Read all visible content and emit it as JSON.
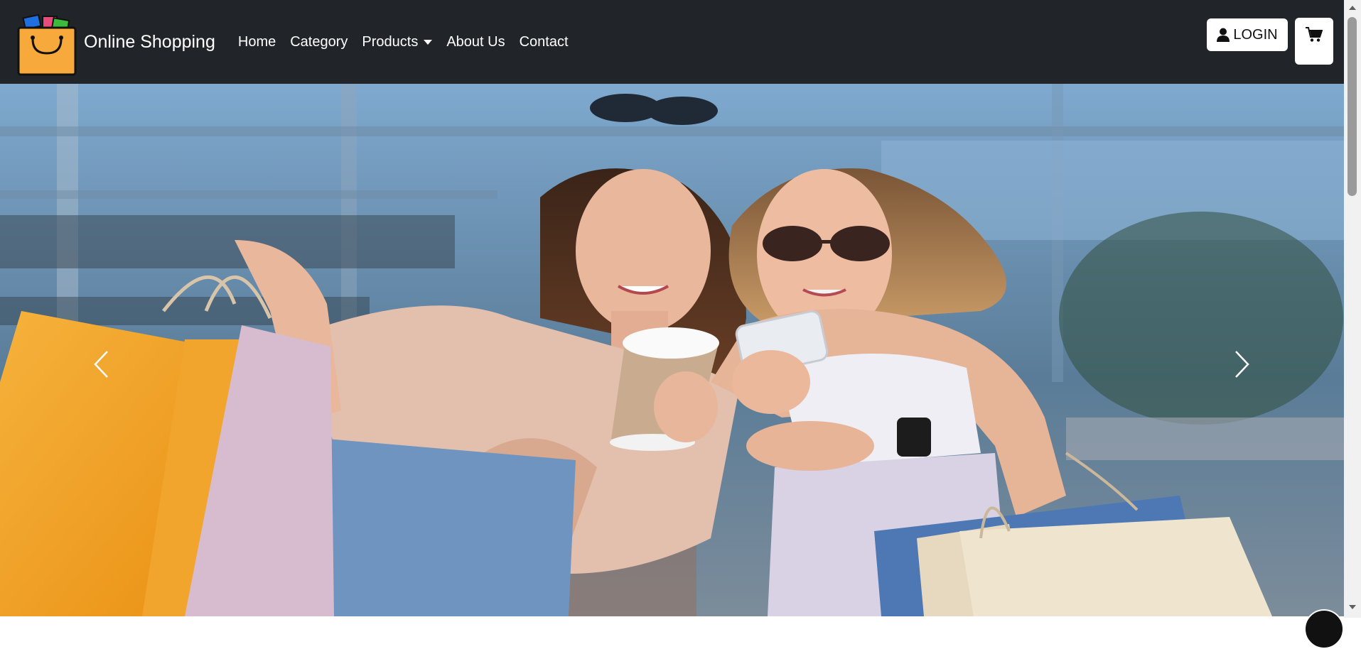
{
  "brand": {
    "name": "Online Shopping",
    "logo_icon": "shopping-bag-icon"
  },
  "nav": {
    "items": [
      {
        "label": "Home"
      },
      {
        "label": "Category"
      },
      {
        "label": "Products",
        "icon": "caret-down-icon"
      },
      {
        "label": "About Us"
      },
      {
        "label": "Contact"
      }
    ]
  },
  "actions": {
    "login_label": "LOGIN",
    "login_icon": "user-icon",
    "cart_icon": "cart-icon"
  },
  "carousel": {
    "prev_icon": "chevron-left-icon",
    "next_icon": "chevron-right-icon"
  },
  "colors": {
    "navbar_bg": "#212529",
    "bag_orange": "#f5a623",
    "button_bg": "#ffffff"
  }
}
